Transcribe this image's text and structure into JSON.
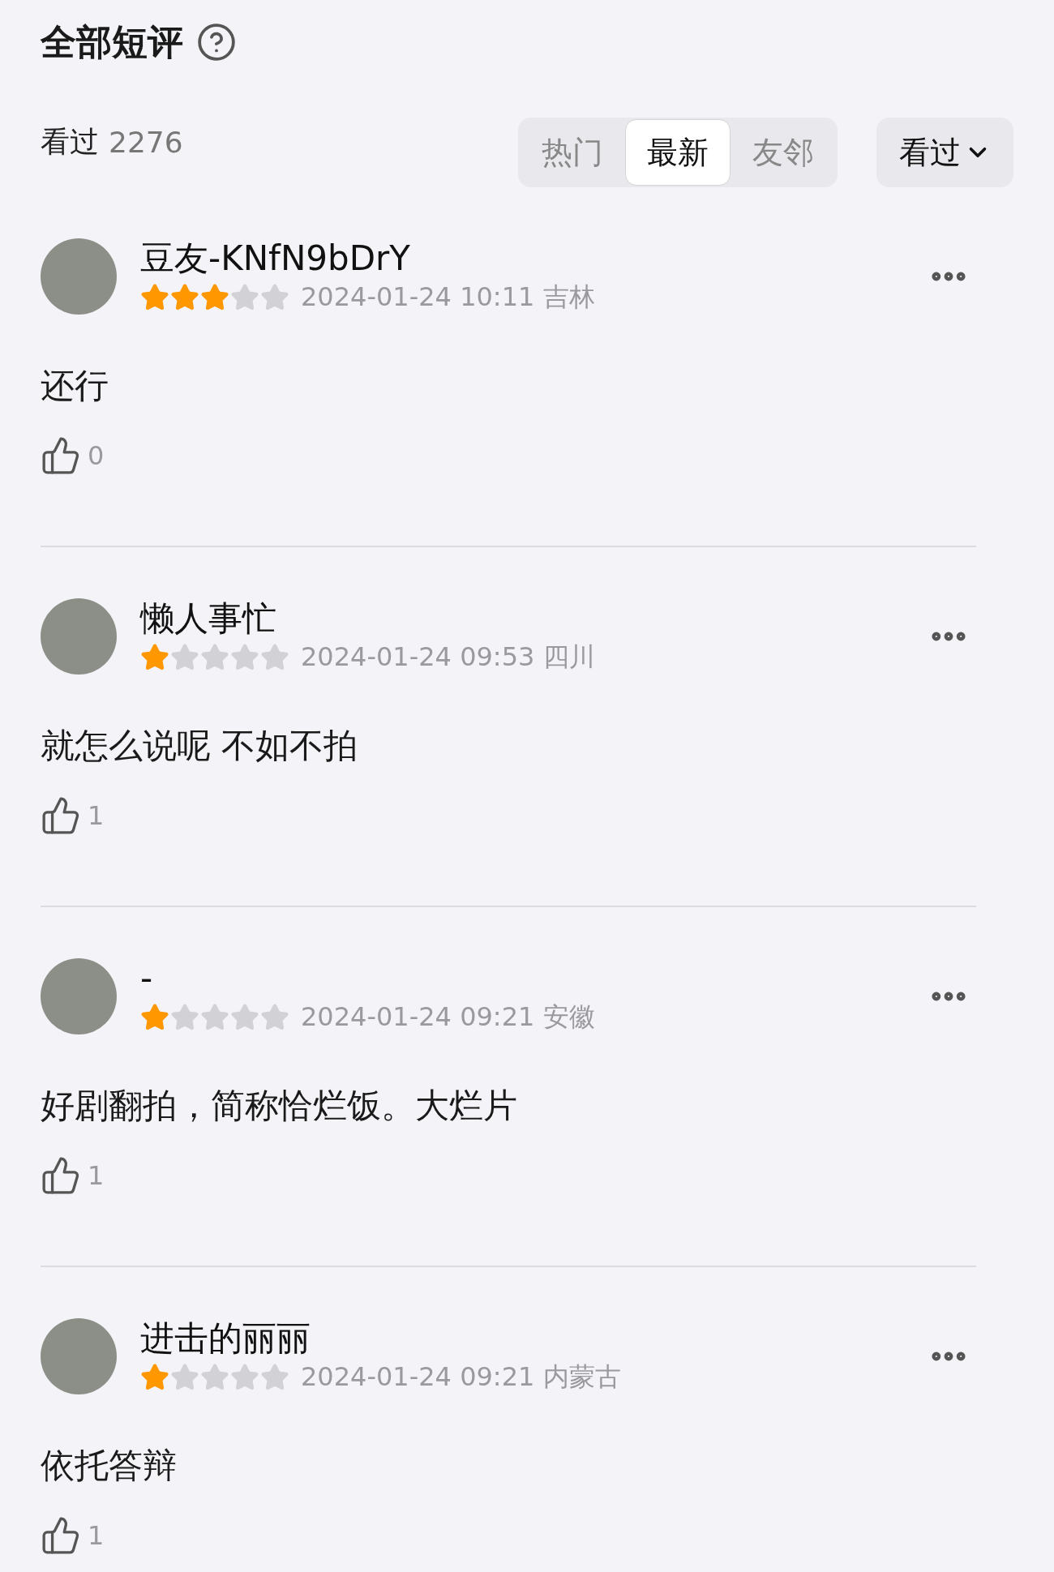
{
  "header": {
    "title": "全部短评"
  },
  "stats": {
    "label": "看过",
    "count": "2276"
  },
  "tabs": [
    {
      "label": "热门",
      "selected": false
    },
    {
      "label": "最新",
      "selected": true
    },
    {
      "label": "友邻",
      "selected": false
    }
  ],
  "filter": {
    "label": "看过"
  },
  "comments": [
    {
      "user": "豆友-KNfN9bDrY",
      "stars": 3,
      "meta": "2024-01-24 10:11 吉林",
      "text": "还行",
      "likes": "0"
    },
    {
      "user": "懒人事忙",
      "stars": 1,
      "meta": "2024-01-24 09:53 四川",
      "text": "就怎么说呢 不如不拍",
      "likes": "1"
    },
    {
      "user": "-",
      "stars": 1,
      "meta": "2024-01-24 09:21 安徽",
      "text": "好剧翻拍，简称恰烂饭。大烂片",
      "likes": "1"
    },
    {
      "user": "进击的丽丽",
      "stars": 1,
      "meta": "2024-01-24 09:21 内蒙古",
      "text": "依托答辩",
      "likes": "1"
    }
  ]
}
